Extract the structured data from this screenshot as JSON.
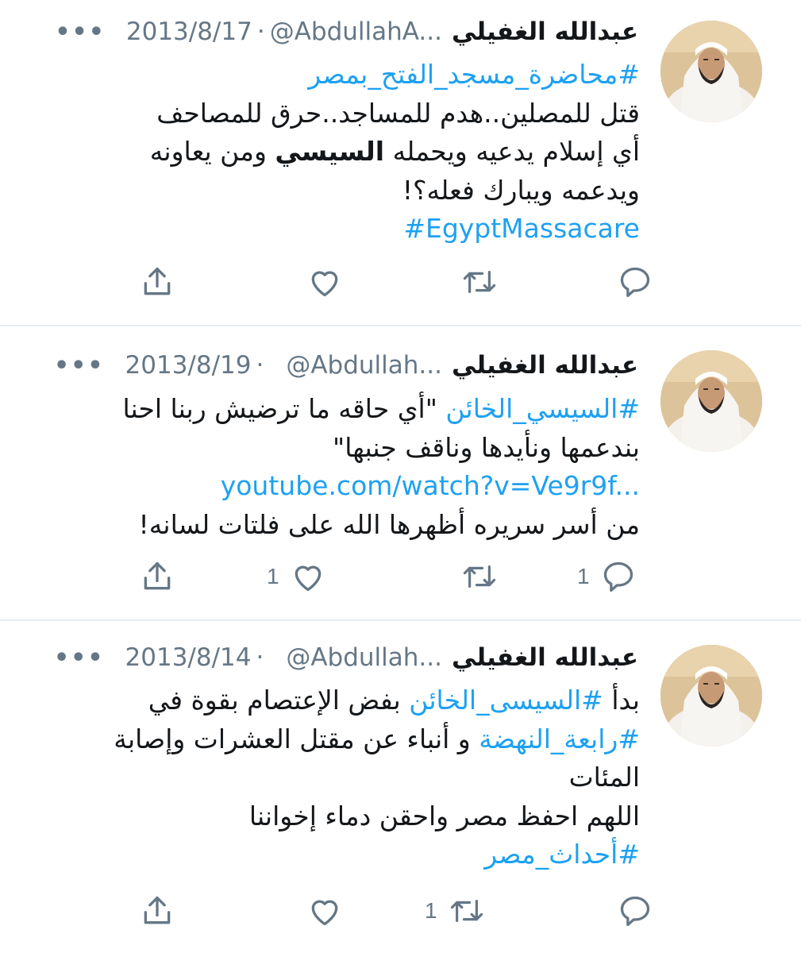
{
  "colors": {
    "link": "#1da1f2",
    "muted": "#657786",
    "text": "#14171a",
    "divider": "#e6ecf0"
  },
  "icons": {
    "more": "more-icon",
    "share": "share-icon",
    "like": "heart-icon",
    "retweet": "retweet-icon",
    "reply": "reply-icon"
  },
  "tweets": [
    {
      "more": "•••",
      "date": "2013/8/17",
      "sep": "·",
      "handle": "@AbdullahA...",
      "name": "عبدالله الغفيلي",
      "hashtag1": "#محاضرة_مسجد_الفتح_بمصر",
      "line2": "قتل للمصلين..هدم للمساجد..حرق للمصاحف",
      "line3_a": "أي إسلام يدعيه ويحمله ",
      "line3_bold": "السيسي",
      "line3_b": " ومن يعاونه",
      "line4": "ويدعمه ويبارك فعله؟!",
      "hashtag2": "#EgyptMassacare",
      "likes": "",
      "retweets": "",
      "replies": ""
    },
    {
      "more": "•••",
      "date": "2013/8/19",
      "sep": "·",
      "handle": "@Abdullah...",
      "name": "عبدالله الغفيلي",
      "hashtag1": "#السيسي_الخائن",
      "line1_rest": " \"أي حاقه ما ترضيش ربنا احنا",
      "line2": "بندعمها ونأيدها وناقف جنبها\"",
      "link": "youtube.com/watch?v=Ve9r9f...",
      "line4": "من أسر سريره أظهرها الله على فلتات لسانه!",
      "likes": "1",
      "retweets": "",
      "replies": "1"
    },
    {
      "more": "•••",
      "date": "2013/8/14",
      "sep": "·",
      "handle": "@Abdullah...",
      "name": "عبدالله الغفيلي",
      "line1_a": "بدأ ",
      "hashtag1": "#السيسى_الخائن",
      "line1_b": " بفض الإعتصام بقوة في",
      "hashtag2": "#رابعة_النهضة",
      "line2_rest": " و أنباء عن مقتل العشرات وإصابة",
      "line3": "المئات",
      "line4": "اللهم احفظ مصر واحقن دماء إخواننا",
      "hashtag3": "#أحداث_مصر",
      "likes": "",
      "retweets": "1",
      "replies": ""
    }
  ]
}
